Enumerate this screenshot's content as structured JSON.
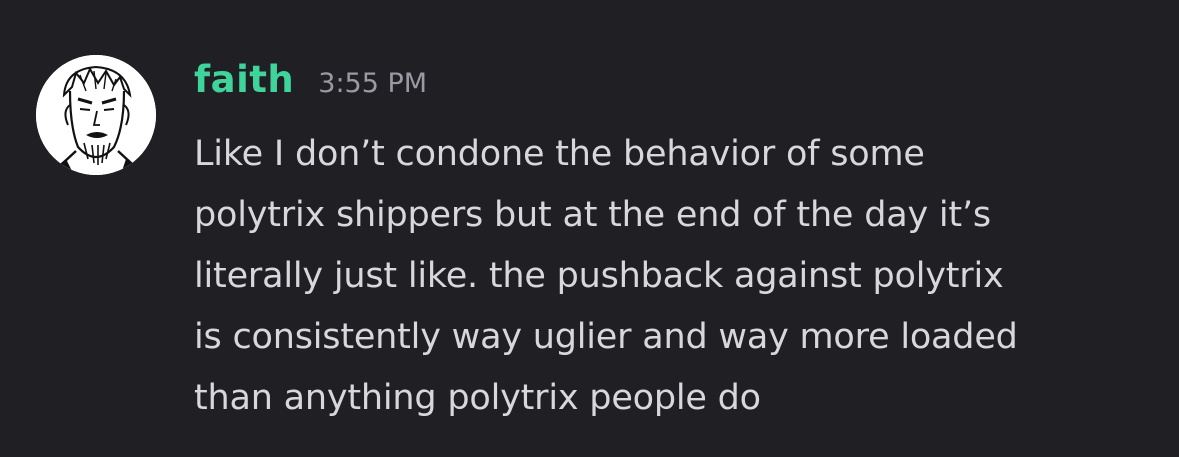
{
  "message": {
    "username": "faith",
    "timestamp": "3:55 PM",
    "text": "Like I don’t condone the behavior of some\npolytrix shippers but at the end of the day it’s\nliterally just like. the pushback against polytrix\nis consistently way uglier and way more loaded\nthan anything polytrix people do",
    "avatar_icon": "manga-character-avatar"
  },
  "colors": {
    "background": "#1f1f24",
    "username": "#3fd49a",
    "timestamp": "#9a9aa3",
    "text": "#d7d7dc"
  }
}
